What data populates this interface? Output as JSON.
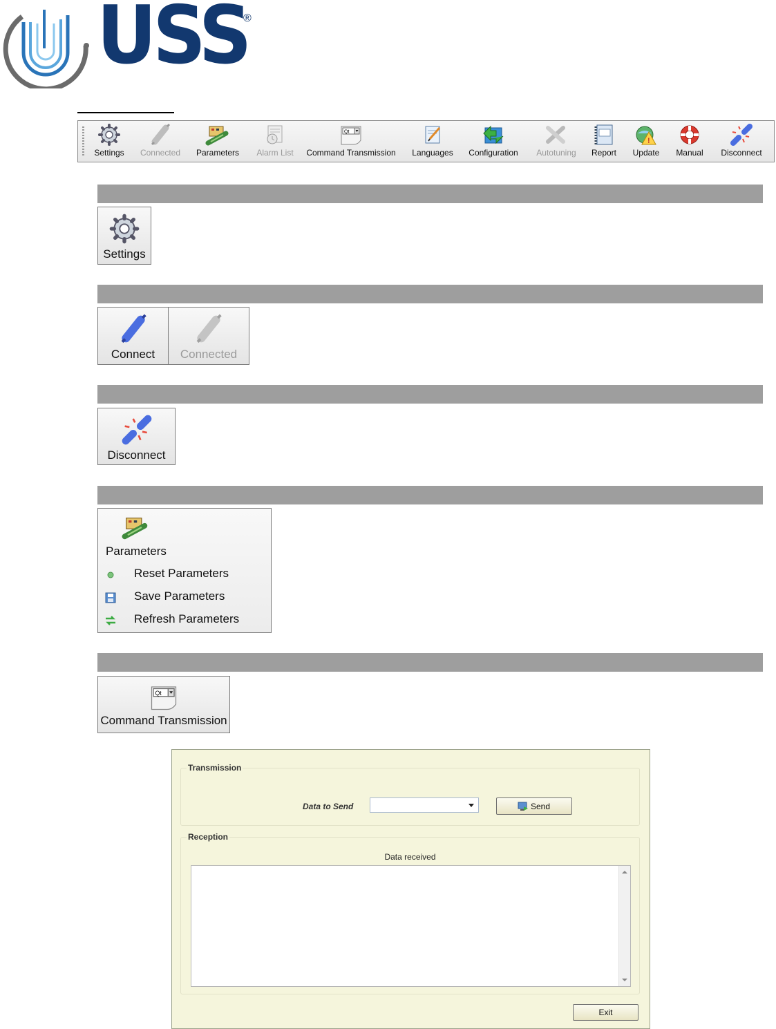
{
  "logo": {
    "text": "USS",
    "reg_mark": "®"
  },
  "toolbar": {
    "items": [
      {
        "label": "Settings",
        "icon": "gear-icon",
        "enabled": true
      },
      {
        "label": "Connected",
        "icon": "plug-icon",
        "enabled": false
      },
      {
        "label": "Parameters",
        "icon": "circuit-board-icon",
        "enabled": true
      },
      {
        "label": "Alarm List",
        "icon": "alarm-list-icon",
        "enabled": false
      },
      {
        "label": "Command Transmission",
        "icon": "command-combo-icon",
        "enabled": true
      },
      {
        "label": "Languages",
        "icon": "languages-icon",
        "enabled": true
      },
      {
        "label": "Configuration",
        "icon": "configuration-icon",
        "enabled": true
      },
      {
        "label": "Autotuning",
        "icon": "tools-icon",
        "enabled": false
      },
      {
        "label": "Report",
        "icon": "report-icon",
        "enabled": true
      },
      {
        "label": "Update",
        "icon": "update-icon",
        "enabled": true
      },
      {
        "label": "Manual",
        "icon": "lifebuoy-icon",
        "enabled": true
      },
      {
        "label": "Disconnect",
        "icon": "disconnect-icon",
        "enabled": true
      }
    ]
  },
  "sections": {
    "settings": {
      "label": "Settings"
    },
    "connect": {
      "connect_label": "Connect",
      "connected_label": "Connected"
    },
    "disconnect": {
      "label": "Disconnect"
    },
    "parameters": {
      "label": "Parameters",
      "menu": [
        {
          "label": "Reset Parameters",
          "icon": "green-dot-icon"
        },
        {
          "label": "Save Parameters",
          "icon": "floppy-disk-icon"
        },
        {
          "label": "Refresh Parameters",
          "icon": "refresh-arrows-icon"
        }
      ]
    },
    "command": {
      "label": "Command Transmission",
      "combo_text": "Qt"
    }
  },
  "dialog": {
    "transmission_legend": "Transmission",
    "data_to_send_label": "Data to Send",
    "data_to_send_value": "",
    "send_label": "Send",
    "reception_legend": "Reception",
    "data_received_label": "Data received",
    "data_received_value": "",
    "exit_label": "Exit"
  },
  "colors": {
    "brand_navy": "#12386f",
    "section_bar": "#9e9e9e",
    "dialog_bg": "#f5f5dc"
  }
}
